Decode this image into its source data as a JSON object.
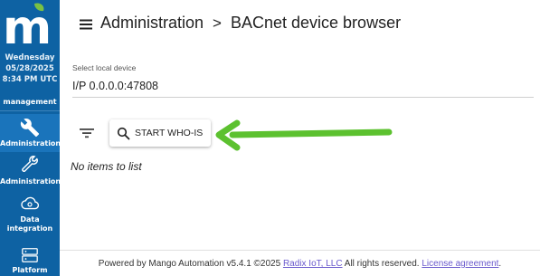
{
  "sidebar": {
    "date_line1": "Wednesday",
    "date_line2": "05/28/2025",
    "time": "8:34 PM UTC",
    "section": "management",
    "items": [
      {
        "label": "Administration",
        "icon": "wrench-icon",
        "active": true
      },
      {
        "label": "Administration",
        "icon": "wrench-alt-icon",
        "active": false
      },
      {
        "label": "Data integration",
        "icon": "cloud-gear-icon",
        "active": false
      },
      {
        "label": "Platform",
        "icon": "server-icon",
        "active": false
      }
    ]
  },
  "header": {
    "crumb1": "Administration",
    "separator": ">",
    "crumb2": "BACnet device browser"
  },
  "device_select": {
    "label": "Select local device",
    "value": "I/P 0.0.0.0:47808"
  },
  "toolbar": {
    "whois_label": "START WHO-IS"
  },
  "list": {
    "empty_message": "No items to list"
  },
  "footer": {
    "text_prefix": "Powered by Mango Automation v5.4.1 ©2025 ",
    "company_link": "Radix IoT, LLC",
    "text_middle": " All rights reserved. ",
    "license_link": "License agreement",
    "text_suffix": "."
  },
  "colors": {
    "sidebar_bg": "#0e62a3",
    "active_item_bg": "#1a74bb",
    "arrow": "#5cc12f",
    "logo_leaf": "#7ac143",
    "link": "#6a5acd"
  }
}
